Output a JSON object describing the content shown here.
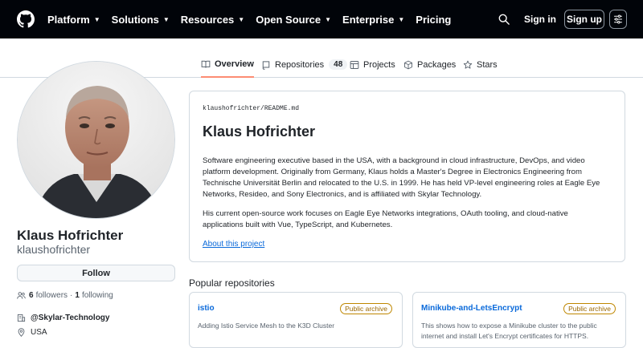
{
  "colors": {
    "header_bg": "#010409",
    "link": "#0969da",
    "active_tab_underline": "#fd8c73",
    "archive_badge": "#9a6700",
    "border": "#d1d9e0"
  },
  "header": {
    "logo_icon": "github-mark-icon",
    "nav": [
      {
        "label": "Platform"
      },
      {
        "label": "Solutions"
      },
      {
        "label": "Resources"
      },
      {
        "label": "Open Source"
      },
      {
        "label": "Enterprise"
      },
      {
        "label": "Pricing"
      }
    ],
    "search_icon": "search-icon",
    "sign_in": "Sign in",
    "sign_up": "Sign up",
    "menu_icon": "sliders-icon"
  },
  "tabs": [
    {
      "label": "Overview",
      "icon": "book-icon",
      "active": true
    },
    {
      "label": "Repositories",
      "icon": "repo-icon",
      "count": "48"
    },
    {
      "label": "Projects",
      "icon": "table-icon"
    },
    {
      "label": "Packages",
      "icon": "package-icon"
    },
    {
      "label": "Stars",
      "icon": "star-icon"
    }
  ],
  "profile": {
    "name": "Klaus Hofrichter",
    "login": "klaushofrichter",
    "follow": "Follow",
    "followers_count": "6",
    "followers_label": "followers",
    "separator": "·",
    "following_count": "1",
    "following_label": "following",
    "org": "@Skylar-Technology",
    "location": "USA"
  },
  "readme": {
    "path_user": "klaushofrichter",
    "path_sep": "/",
    "path_file": "README.md",
    "title": "Klaus Hofrichter",
    "paragraph1": "Software engineering executive based in the USA, with a background in cloud infrastructure, DevOps, and video platform development. Originally from Germany, Klaus holds a Master's Degree in Electronics Engineering from Technische Universität Berlin and relocated to the U.S. in 1999. He has held VP-level engineering roles at Eagle Eye Networks, Resideo, and Sony Electronics, and is affiliated with Skylar Technology.",
    "paragraph2": "His current open-source work focuses on Eagle Eye Networks integrations, OAuth tooling, and cloud-native applications built with Vue, TypeScript, and Kubernetes.",
    "link": "About this project"
  },
  "popular": {
    "title": "Popular repositories",
    "repos": [
      {
        "name": "istio",
        "badge": "Public archive",
        "description": "Adding Istio Service Mesh to the K3D Cluster"
      },
      {
        "name": "Minikube-and-LetsEncrypt",
        "badge": "Public archive",
        "description": "This shows how to expose a Minikube cluster to the public internet and install Let's Encrypt certificates for HTTPS."
      }
    ]
  }
}
